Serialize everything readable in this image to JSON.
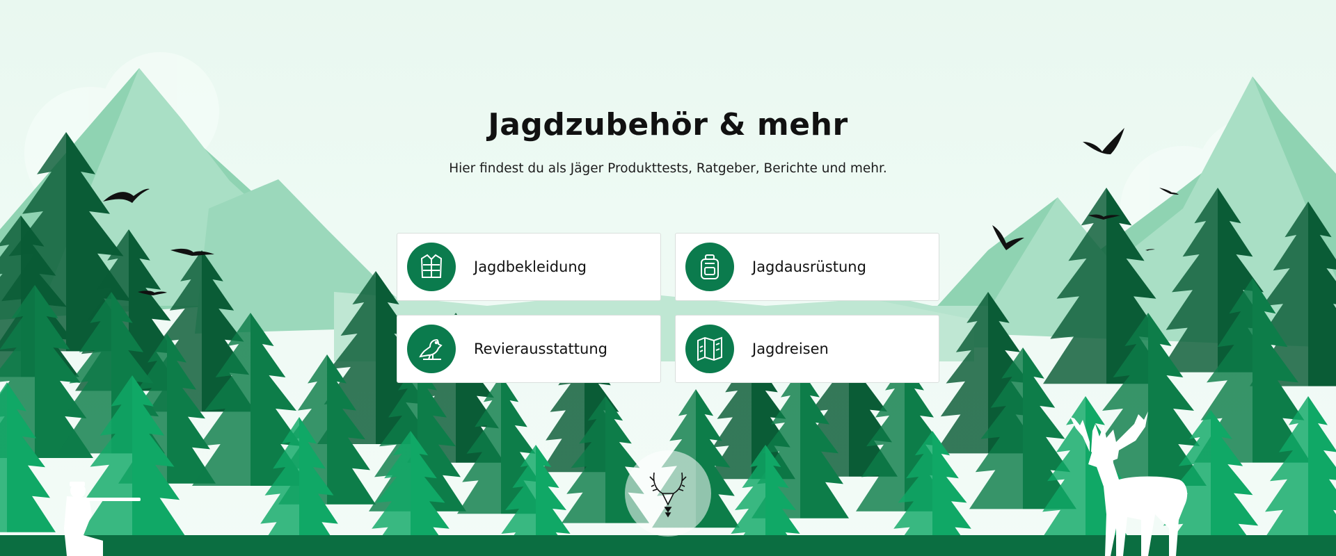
{
  "hero": {
    "title": "Jagdzubehör & mehr",
    "subtitle": "Hier findest du als Jäger Produkttests, Ratgeber, Berichte und mehr."
  },
  "categories": [
    {
      "label": "Jagdbekleidung",
      "icon": "vest-icon"
    },
    {
      "label": "Jagdausrüstung",
      "icon": "backpack-icon"
    },
    {
      "label": "Revierausstattung",
      "icon": "bird-icon"
    },
    {
      "label": "Jagdreisen",
      "icon": "map-icon"
    }
  ],
  "scroll_button": {
    "icon": "deer-antler-icon"
  },
  "colors": {
    "icon_circle": "#0b7b4d",
    "forest_dark": "#0a5c36",
    "forest_mid": "#0d7d49",
    "forest_light": "#10a866",
    "mountain": "#a3dbc0"
  }
}
